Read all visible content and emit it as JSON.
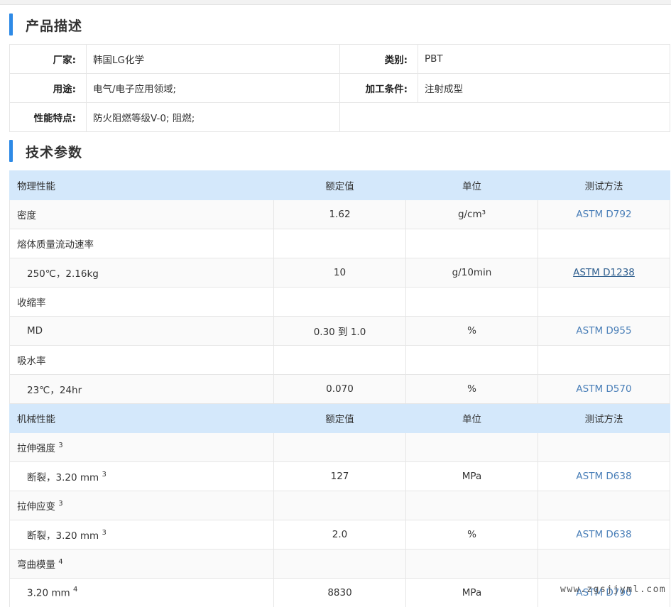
{
  "product_description": {
    "title": "产品描述",
    "rows": [
      [
        {
          "key": "厂家:",
          "value": "韩国LG化学"
        },
        {
          "key": "类别:",
          "value": "PBT"
        }
      ],
      [
        {
          "key": "用途:",
          "value": "电气/电子应用领域;"
        },
        {
          "key": "加工条件:",
          "value": "注射成型"
        }
      ],
      [
        {
          "key": "性能特点:",
          "value": "防火阻燃等级V-0; 阻燃;"
        }
      ]
    ]
  },
  "tech_params": {
    "title": "技术参数",
    "physical_header": {
      "c1": "物理性能",
      "c2": "额定值",
      "c3": "单位",
      "c4": "测试方法"
    },
    "mechanical_header": {
      "c1": "机械性能",
      "c2": "额定值",
      "c3": "单位",
      "c4": "测试方法"
    },
    "rows": {
      "density": {
        "name": "密度",
        "value": "1.62",
        "unit": "g/cm³",
        "method": "ASTM D792"
      },
      "mfr": {
        "name": "熔体质量流动速率"
      },
      "mfr_cond": {
        "name": "250℃，2.16kg",
        "value": "10",
        "unit": "g/10min",
        "method": "ASTM D1238"
      },
      "shrink": {
        "name": "收缩率"
      },
      "shrink_md": {
        "name": "MD",
        "value": "0.30 到 1.0",
        "unit": "%",
        "method": "ASTM D955"
      },
      "water": {
        "name": "吸水率"
      },
      "water_cond": {
        "name": "23℃，24hr",
        "value": "0.070",
        "unit": "%",
        "method": "ASTM D570"
      },
      "tensile_strength": {
        "name": "拉伸强度",
        "sup": "3"
      },
      "ts_break": {
        "name": "断裂，3.20 mm",
        "sup": "3",
        "value": "127",
        "unit": "MPa",
        "method": "ASTM D638"
      },
      "tensile_strain": {
        "name": "拉伸应变",
        "sup": "3"
      },
      "tst_break": {
        "name": "断裂，3.20 mm",
        "sup": "3",
        "value": "2.0",
        "unit": "%",
        "method": "ASTM D638"
      },
      "flex_mod": {
        "name": "弯曲模量",
        "sup": "4"
      },
      "fm_cond": {
        "name": "3.20 mm",
        "sup": "4",
        "value": "8830",
        "unit": "MPa",
        "method": "ASTM D790"
      }
    }
  },
  "watermark": "www.zgsjjyml.com",
  "colors": {
    "accent": "#2e8ae6",
    "header_bg": "#d4e8fb",
    "link": "#4a7fb8"
  }
}
